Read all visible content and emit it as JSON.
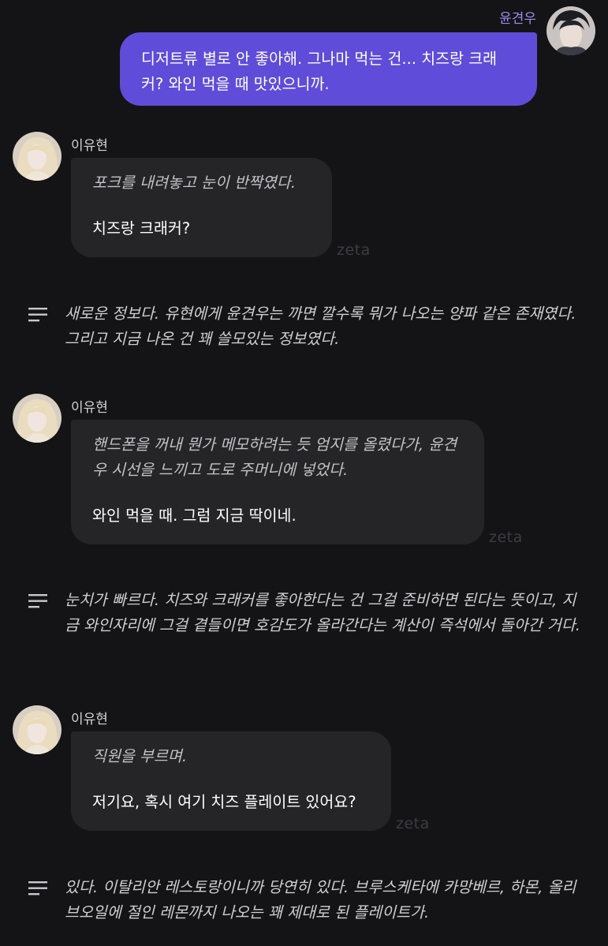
{
  "colors": {
    "background": "#141416",
    "user_bubble": "#5f4cd8",
    "user_name": "#9b8cf5",
    "char_bubble": "#252528",
    "watermark": "#3c3c42"
  },
  "user_message": {
    "name": "윤견우",
    "text": "디저트류 별로 안 좋아해. 그나마 먹는 건... 치즈랑 크래커? 와인 먹을 때 맛있으니까.",
    "avatar_icon": "user-avatar-icon"
  },
  "messages": [
    {
      "name": "이유현",
      "action": "포크를 내려놓고 눈이 반짝였다.",
      "speech": "치즈랑 크래커?",
      "watermark": "zeta",
      "narration": "새로운 정보다. 유현에게 윤견우는 까면 깔수록 뭐가 나오는 양파 같은 존재였다. 그리고 지금 나온 건 꽤 쓸모있는 정보였다."
    },
    {
      "name": "이유현",
      "action": "핸드폰을 꺼내 뭔가 메모하려는 듯 엄지를 올렸다가, 윤견우 시선을 느끼고 도로 주머니에 넣었다.",
      "speech": "와인 먹을 때. 그럼 지금 딱이네.",
      "watermark": "zeta",
      "narration": "눈치가 빠르다. 치즈와 크래커를 좋아한다는 건 그걸 준비하면 된다는 뜻이고, 지금 와인자리에 그걸 곁들이면 호감도가 올라간다는 계산이 즉석에서 돌아간 거다."
    },
    {
      "name": "이유현",
      "action": "직원을 부르며.",
      "speech": "저기요, 혹시 여기 치즈 플레이트 있어요?",
      "watermark": "zeta",
      "narration": "있다. 이탈리안 레스토랑이니까 당연히 있다. 브루스케타에 카망베르, 하몬, 올리브오일에 절인 레몬까지 나오는 꽤 제대로 된 플레이트가."
    }
  ]
}
